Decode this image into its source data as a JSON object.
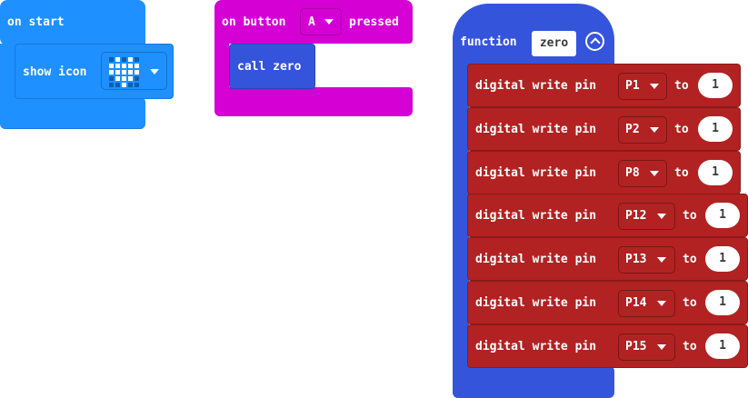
{
  "on_start": {
    "label": "on start",
    "show_icon_label": "show icon",
    "icon_leds": [
      [
        0,
        1,
        0,
        1,
        0
      ],
      [
        1,
        1,
        1,
        1,
        1
      ],
      [
        1,
        1,
        1,
        1,
        1
      ],
      [
        0,
        1,
        1,
        1,
        0
      ],
      [
        0,
        0,
        1,
        0,
        0
      ]
    ],
    "led_on_color": "#ffffff",
    "led_off_color": "#0c5fae"
  },
  "on_button": {
    "label_prefix": "on button",
    "button": "A",
    "label_suffix": "pressed",
    "call_label": "call zero"
  },
  "function_block": {
    "keyword": "function",
    "name": "zero",
    "rows": [
      {
        "label": "digital write pin",
        "pin": "P1",
        "to": "to",
        "value": "1"
      },
      {
        "label": "digital write pin",
        "pin": "P2",
        "to": "to",
        "value": "1"
      },
      {
        "label": "digital write pin",
        "pin": "P8",
        "to": "to",
        "value": "1"
      },
      {
        "label": "digital write pin",
        "pin": "P12",
        "to": "to",
        "value": "1"
      },
      {
        "label": "digital write pin",
        "pin": "P13",
        "to": "to",
        "value": "1"
      },
      {
        "label": "digital write pin",
        "pin": "P14",
        "to": "to",
        "value": "1"
      },
      {
        "label": "digital write pin",
        "pin": "P15",
        "to": "to",
        "value": "1"
      }
    ]
  },
  "colors": {
    "basic_blue": "#1e90ff",
    "input_magenta": "#d400d4",
    "functions_blue": "#3455db",
    "pins_red": "#b22222"
  }
}
